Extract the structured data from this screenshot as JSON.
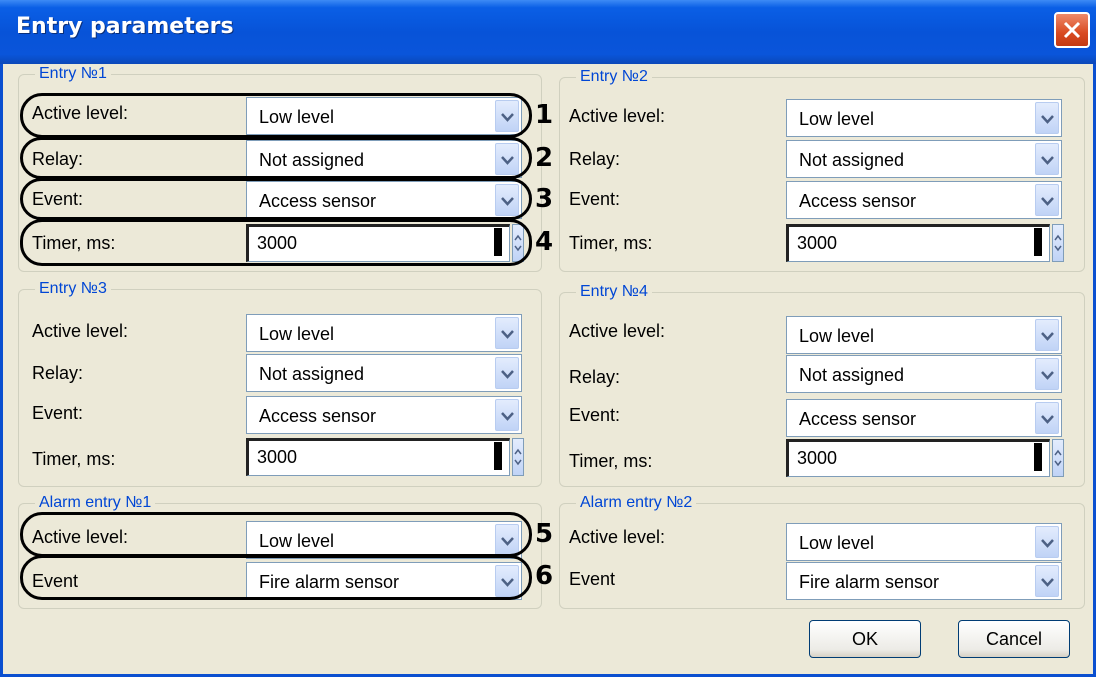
{
  "window": {
    "title": "Entry parameters"
  },
  "labels": {
    "active_level": "Active level:",
    "relay": "Relay:",
    "event": "Event:",
    "timer": "Timer, ms:",
    "event_plain": "Event"
  },
  "entries": [
    {
      "title": "Entry №1",
      "active_level": "Low level",
      "relay": "Not assigned",
      "event": "Access sensor",
      "timer": "3000"
    },
    {
      "title": "Entry №2",
      "active_level": "Low level",
      "relay": "Not assigned",
      "event": "Access sensor",
      "timer": "3000"
    },
    {
      "title": "Entry №3",
      "active_level": "Low level",
      "relay": "Not assigned",
      "event": "Access sensor",
      "timer": "3000"
    },
    {
      "title": "Entry №4",
      "active_level": "Low level",
      "relay": "Not assigned",
      "event": "Access sensor",
      "timer": "3000"
    }
  ],
  "alarm_entries": [
    {
      "title": "Alarm entry №1",
      "active_level": "Low level",
      "event": "Fire alarm sensor"
    },
    {
      "title": "Alarm entry №2",
      "active_level": "Low level",
      "event": "Fire alarm sensor"
    }
  ],
  "callouts": [
    "1",
    "2",
    "3",
    "4",
    "5",
    "6"
  ],
  "buttons": {
    "ok": "OK",
    "cancel": "Cancel"
  },
  "colors": {
    "titlebar": "#0753d8",
    "group_title": "#0046d5",
    "dialog_bg": "#ece9d8"
  }
}
